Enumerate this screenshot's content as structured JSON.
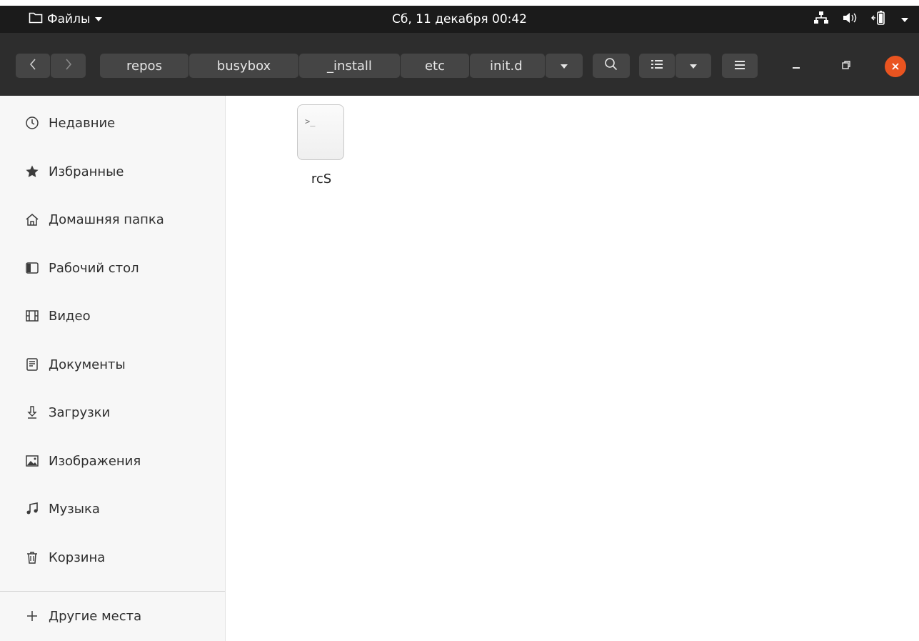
{
  "topbar": {
    "app_name": "Файлы",
    "datetime": "Сб, 11 декабря  00:42"
  },
  "header": {
    "breadcrumbs": [
      "repos",
      "busybox",
      "_install",
      "etc",
      "init.d"
    ]
  },
  "sidebar": {
    "items": [
      {
        "label": "Недавние",
        "icon": "clock-icon"
      },
      {
        "label": "Избранные",
        "icon": "star-icon"
      },
      {
        "label": "Домашняя папка",
        "icon": "home-icon"
      },
      {
        "label": "Рабочий стол",
        "icon": "desktop-icon"
      },
      {
        "label": "Видео",
        "icon": "video-icon"
      },
      {
        "label": "Документы",
        "icon": "document-icon"
      },
      {
        "label": "Загрузки",
        "icon": "download-icon"
      },
      {
        "label": "Изображения",
        "icon": "image-icon"
      },
      {
        "label": "Музыка",
        "icon": "music-icon"
      },
      {
        "label": "Корзина",
        "icon": "trash-icon"
      }
    ],
    "other_places": "Другие места"
  },
  "files": [
    {
      "name": "rcS",
      "icon": "script-file-icon"
    }
  ],
  "colors": {
    "topbar_bg": "#1b1b1b",
    "headerbar_bg": "#2d2d2d",
    "button_bg": "#454545",
    "close_button": "#e95420",
    "sidebar_bg": "#f7f7f7"
  }
}
